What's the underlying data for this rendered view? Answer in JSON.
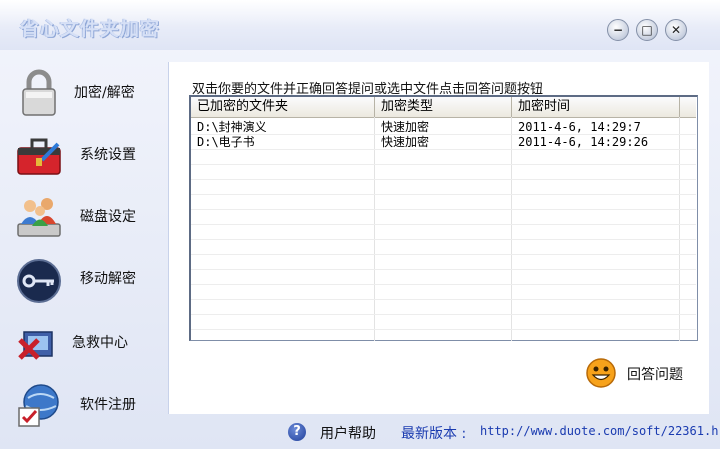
{
  "window": {
    "title": "省心文件夹加密",
    "buttons": {
      "minimize": "−",
      "maximize": "□",
      "close": "✕"
    }
  },
  "sidebar": {
    "items": [
      {
        "label": "加密/解密",
        "icon": "padlock-icon"
      },
      {
        "label": "系统设置",
        "icon": "toolbox-icon"
      },
      {
        "label": "磁盘设定",
        "icon": "users-disk-icon"
      },
      {
        "label": "移动解密",
        "icon": "key-disc-icon"
      },
      {
        "label": "急救中心",
        "icon": "rescue-icon"
      },
      {
        "label": "软件注册",
        "icon": "register-icon"
      }
    ]
  },
  "main": {
    "instruction": "双击你要的文件并正确回答提问或选中文件点击回答问题按钮",
    "table": {
      "columns": [
        "已加密的文件夹",
        "加密类型",
        "加密时间"
      ],
      "rows": [
        [
          "D:\\封神演义",
          "快速加密",
          "2011-4-6, 14:29:7"
        ],
        [
          "D:\\电子书",
          "快速加密",
          "2011-4-6, 14:29:26"
        ]
      ]
    },
    "answer_button": "回答问题"
  },
  "footer": {
    "help": "用户帮助",
    "version_label": "最新版本 :",
    "version_url": "http://www.duote.com/soft/22361.h"
  },
  "colors": {
    "accent": "#1a3bb0",
    "background": "#e8ecf8"
  }
}
